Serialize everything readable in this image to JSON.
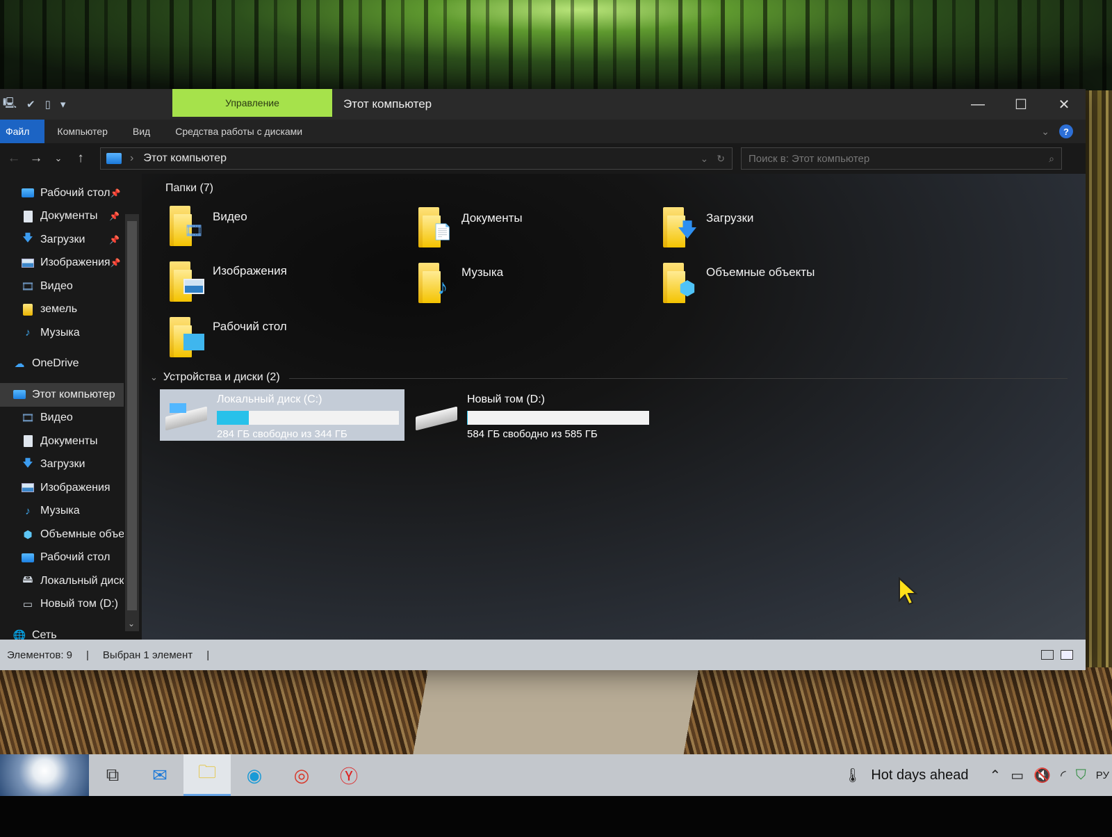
{
  "window": {
    "title": "Этот компьютер",
    "manage_tab": "Управление",
    "controls": {
      "minimize": "—",
      "maximize": "☐",
      "close": "✕"
    }
  },
  "ribbon": {
    "tabs": [
      {
        "label": "Файл"
      },
      {
        "label": "Компьютер"
      },
      {
        "label": "Вид"
      },
      {
        "label": "Средства работы с дисками"
      }
    ],
    "help": "?"
  },
  "address": {
    "path": "Этот компьютер",
    "search_placeholder": "Поиск в: Этот компьютер"
  },
  "sidebar": {
    "quick_access": [
      {
        "label": "Рабочий стол",
        "icon": "desktop-icon",
        "pinned": true
      },
      {
        "label": "Документы",
        "icon": "document-icon",
        "pinned": true
      },
      {
        "label": "Загрузки",
        "icon": "download-icon",
        "pinned": true
      },
      {
        "label": "Изображения",
        "icon": "pictures-icon",
        "pinned": true
      },
      {
        "label": "Видео",
        "icon": "video-icon",
        "pinned": false
      },
      {
        "label": "земель",
        "icon": "folder-icon",
        "pinned": false
      },
      {
        "label": "Музыка",
        "icon": "music-icon",
        "pinned": false
      }
    ],
    "onedrive": "OneDrive",
    "this_pc": "Этот компьютер",
    "pc_children": [
      {
        "label": "Видео",
        "icon": "video-icon"
      },
      {
        "label": "Документы",
        "icon": "document-icon"
      },
      {
        "label": "Загрузки",
        "icon": "download-icon"
      },
      {
        "label": "Изображения",
        "icon": "pictures-icon"
      },
      {
        "label": "Музыка",
        "icon": "music-icon"
      },
      {
        "label": "Объемные объекты",
        "icon": "3d-objects-icon"
      },
      {
        "label": "Рабочий стол",
        "icon": "desktop-icon"
      },
      {
        "label": "Локальный диск (C:)",
        "icon": "local-disk-icon"
      },
      {
        "label": "Новый том (D:)",
        "icon": "drive-icon"
      }
    ],
    "network": "Сеть"
  },
  "content": {
    "folders_header": "Папки (7)",
    "folders": [
      {
        "name": "Видео",
        "icon": "video-folder-icon"
      },
      {
        "name": "Документы",
        "icon": "documents-folder-icon"
      },
      {
        "name": "Загрузки",
        "icon": "downloads-folder-icon"
      },
      {
        "name": "Изображения",
        "icon": "pictures-folder-icon"
      },
      {
        "name": "Музыка",
        "icon": "music-folder-icon"
      },
      {
        "name": "Объемные объекты",
        "icon": "3d-objects-folder-icon"
      },
      {
        "name": "Рабочий стол",
        "icon": "desktop-folder-icon"
      }
    ],
    "devices_header": "Устройства и диски (2)",
    "drives": [
      {
        "name": "Локальный диск (C:)",
        "free_text": "284 ГБ свободно из 344 ГБ",
        "free_gb": 284,
        "total_gb": 344,
        "selected": true
      },
      {
        "name": "Новый том (D:)",
        "free_text": "584 ГБ свободно из 585 ГБ",
        "free_gb": 584,
        "total_gb": 585,
        "selected": false
      }
    ]
  },
  "status": {
    "items_count": "Элементов: 9",
    "selected": "Выбран 1 элемент"
  },
  "taskbar": {
    "weather": "Hot days ahead",
    "lang": "РУ"
  },
  "colors": {
    "manage_tab": "#a6e24b",
    "file_tab": "#1c64c4",
    "drive_bar_fill": "#27c1ea"
  }
}
